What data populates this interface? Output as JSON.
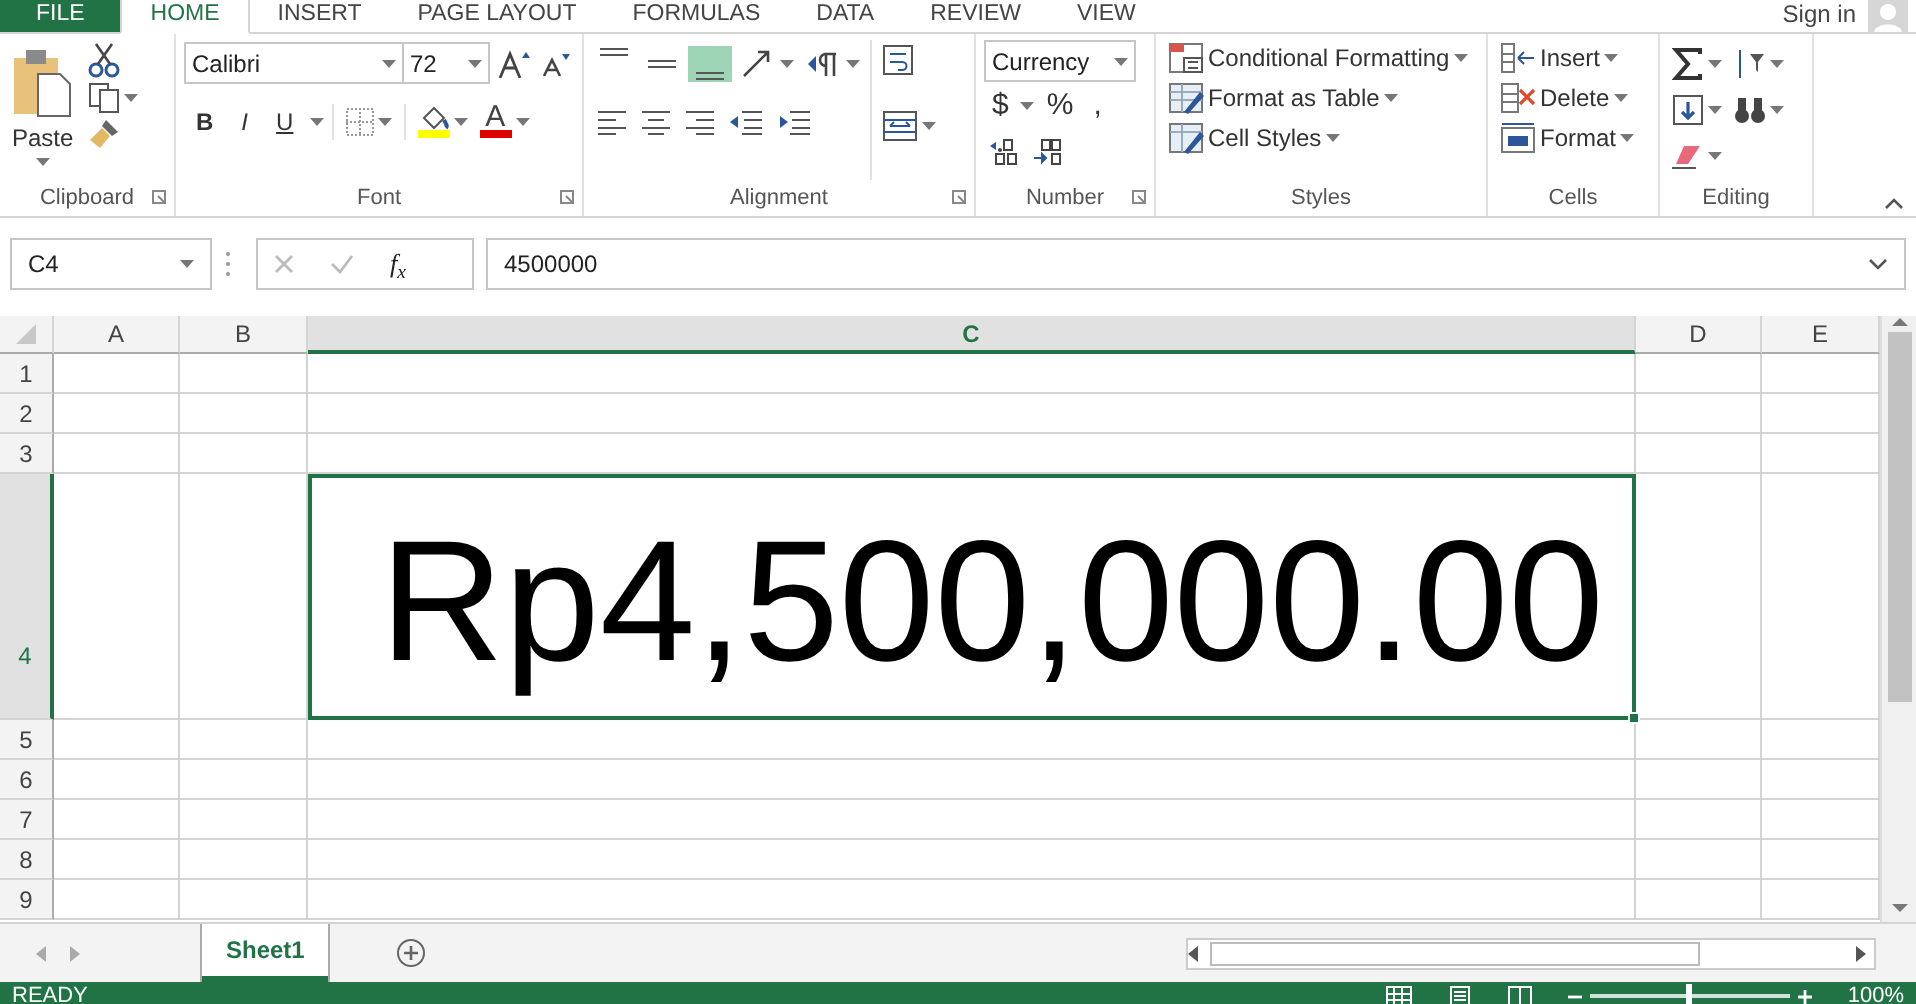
{
  "ribbon_tabs": [
    {
      "label": "FILE",
      "kind": "file",
      "selected": false
    },
    {
      "label": "HOME",
      "kind": "tab",
      "selected": true
    },
    {
      "label": "INSERT",
      "kind": "tab",
      "selected": false
    },
    {
      "label": "PAGE LAYOUT",
      "kind": "tab",
      "selected": false
    },
    {
      "label": "FORMULAS",
      "kind": "tab",
      "selected": false
    },
    {
      "label": "DATA",
      "kind": "tab",
      "selected": false
    },
    {
      "label": "REVIEW",
      "kind": "tab",
      "selected": false
    },
    {
      "label": "VIEW",
      "kind": "tab",
      "selected": false
    }
  ],
  "account": {
    "label": "Sign in"
  },
  "clipboard": {
    "paste_label": "Paste",
    "group_label": "Clipboard"
  },
  "font": {
    "font_name": "Calibri",
    "font_size": "72",
    "style_buttons": [
      "B",
      "I",
      "U"
    ],
    "font_color_label": "A",
    "group_label": "Font"
  },
  "alignment": {
    "vertical_buttons": [
      {
        "selected": false
      },
      {
        "selected": false
      },
      {
        "selected": true
      }
    ],
    "group_label": "Alignment"
  },
  "number": {
    "format": "Currency",
    "symbols": [
      "$",
      "%",
      ","
    ],
    "group_label": "Number"
  },
  "styles": {
    "items": [
      "Conditional Formatting",
      "Format as Table",
      "Cell Styles"
    ],
    "group_label": "Styles"
  },
  "cells": {
    "items": [
      "Insert",
      "Delete",
      "Format"
    ],
    "group_label": "Cells"
  },
  "editing": {
    "group_label": "Editing"
  },
  "formula_bar": {
    "name_box": "C4",
    "function_label": "f$_{x}$",
    "value": "4500000"
  },
  "sheet": {
    "columns": [
      {
        "label": "A",
        "selected": false
      },
      {
        "label": "B",
        "selected": false
      },
      {
        "label": "C",
        "selected": true
      },
      {
        "label": "D",
        "selected": false
      },
      {
        "label": "E",
        "selected": false
      }
    ],
    "rows": [
      {
        "label": "1",
        "selected": false
      },
      {
        "label": "2",
        "selected": false
      },
      {
        "label": "3",
        "selected": false
      },
      {
        "label": "4",
        "selected": true
      },
      {
        "label": "5",
        "selected": false
      },
      {
        "label": "6",
        "selected": false
      },
      {
        "label": "7",
        "selected": false
      },
      {
        "label": "8",
        "selected": false
      },
      {
        "label": "9",
        "selected": false
      }
    ],
    "active_cell_value": "Rp4,500,000.00"
  },
  "sheet_tabs": [
    {
      "label": "Sheet1",
      "selected": true
    }
  ],
  "status_bar": {
    "status": "READY",
    "zoom": "100%",
    "zoom_level": {
      "level": 0.5
    }
  }
}
